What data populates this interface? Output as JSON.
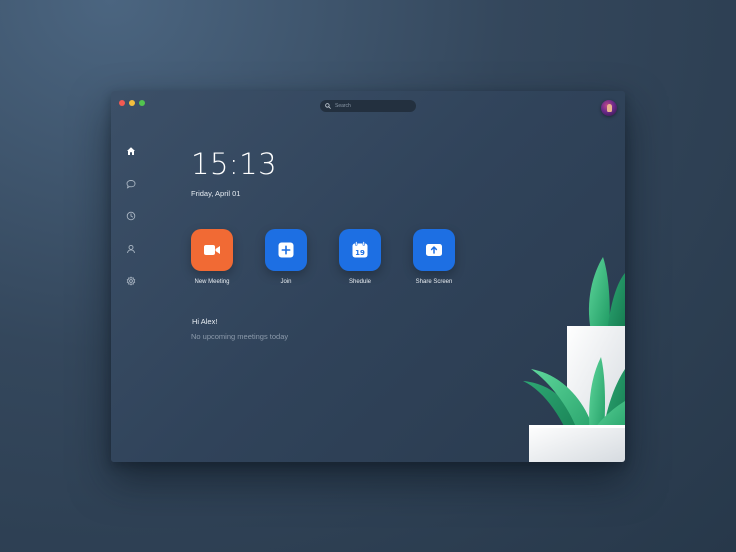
{
  "window": {
    "search_placeholder": "Search"
  },
  "sidebar": {
    "items": [
      {
        "icon": "home-icon"
      },
      {
        "icon": "chat-icon"
      },
      {
        "icon": "clock-icon"
      },
      {
        "icon": "contacts-icon"
      },
      {
        "icon": "settings-icon"
      }
    ]
  },
  "clock": {
    "time": "15:13",
    "date": "Friday, April 01"
  },
  "actions": [
    {
      "label": "New Meeting",
      "icon": "video-camera-icon",
      "color": "#f16a34"
    },
    {
      "label": "Join",
      "icon": "plus-icon",
      "color": "#1d6fe3"
    },
    {
      "label": "Shedule",
      "icon": "calendar-icon",
      "calendar_day": "19",
      "color": "#1d6fe3"
    },
    {
      "label": "Share Screen",
      "icon": "share-screen-icon",
      "color": "#1d6fe3"
    }
  ],
  "meetings": {
    "greeting": "Hi Alex!",
    "empty_message": "No upcoming meetings today"
  },
  "colors": {
    "accent_orange": "#f16a34",
    "accent_blue": "#1d6fe3",
    "plant_green": "#2fb77a"
  }
}
